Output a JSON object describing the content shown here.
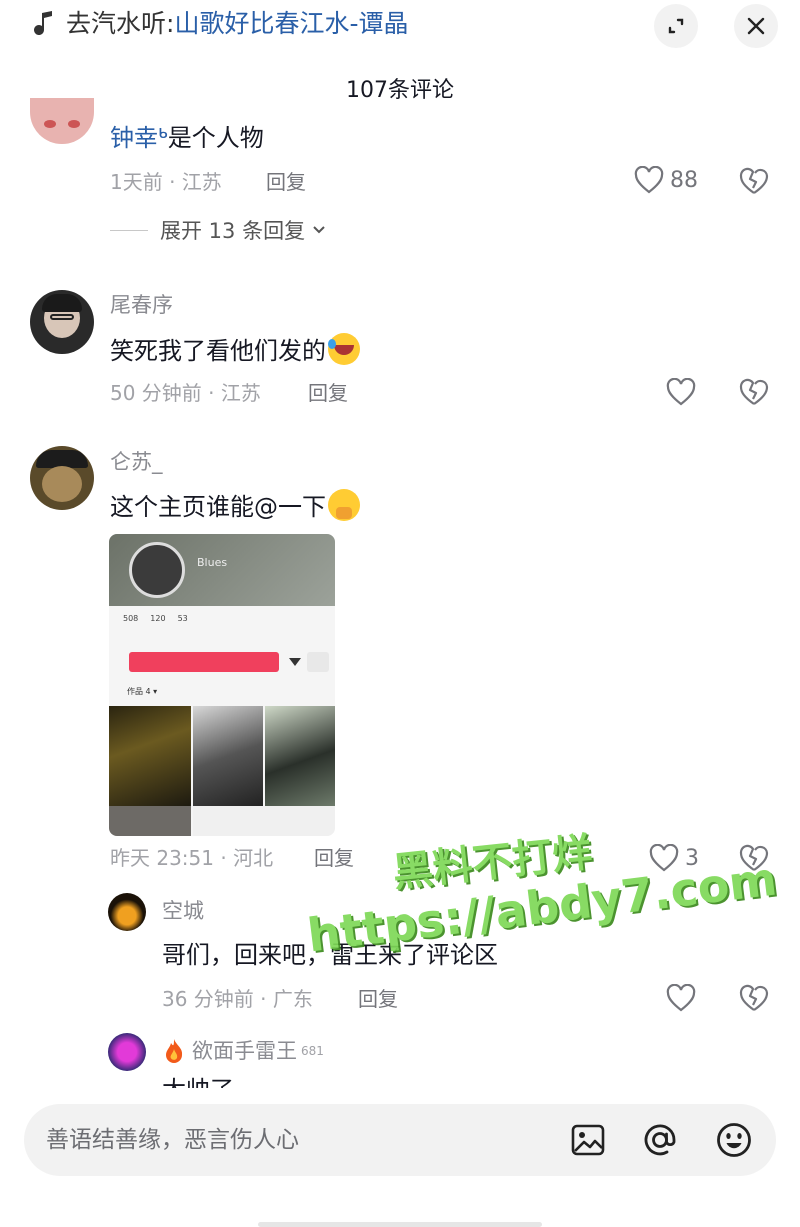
{
  "header": {
    "music_prefix": "去汽水听:",
    "song_title": "山歌好比春江水-谭晶",
    "comment_count_title": "107条评论"
  },
  "comments": [
    {
      "username": "",
      "text_mention": "钟幸ᒃ",
      "text": "是个人物",
      "time_location": "1天前 · 江苏",
      "reply_label": "回复",
      "like_count": "88",
      "expand_label": "展开 13 条回复"
    },
    {
      "username": "尾春序",
      "text": "笑死我了看他们发的",
      "emoji": "crying-laughing-emoji",
      "time_location": "50 分钟前 · 江苏",
      "reply_label": "回复",
      "like_count": ""
    },
    {
      "username": "仑苏_",
      "text": "这个主页谁能@一下",
      "emoji": "pleading-hands-emoji",
      "time_location": "昨天 23:51 · 河北",
      "reply_label": "回复",
      "like_count": "3",
      "image": {
        "profile_name": "Blues",
        "stats": [
          "508",
          "120",
          "53"
        ],
        "tab_label": "作品 4 ▾"
      },
      "replies": [
        {
          "username": "空城",
          "text": "哥们，回来吧，雷王来了评论区",
          "time_location": "36 分钟前 · 广东",
          "reply_label": "回复",
          "like_count": ""
        },
        {
          "username": "欲面手雷王",
          "badge": "681",
          "text": "太帅了"
        }
      ]
    }
  ],
  "watermark": {
    "line1": "黑料不打烊",
    "line2": "https://abdy7.com"
  },
  "input": {
    "placeholder": "善语结善缘，恶言伤人心"
  },
  "colors": {
    "accent_link": "#2a5fa8",
    "follow_red": "#f0405d",
    "watermark_green": "#7ed957"
  }
}
